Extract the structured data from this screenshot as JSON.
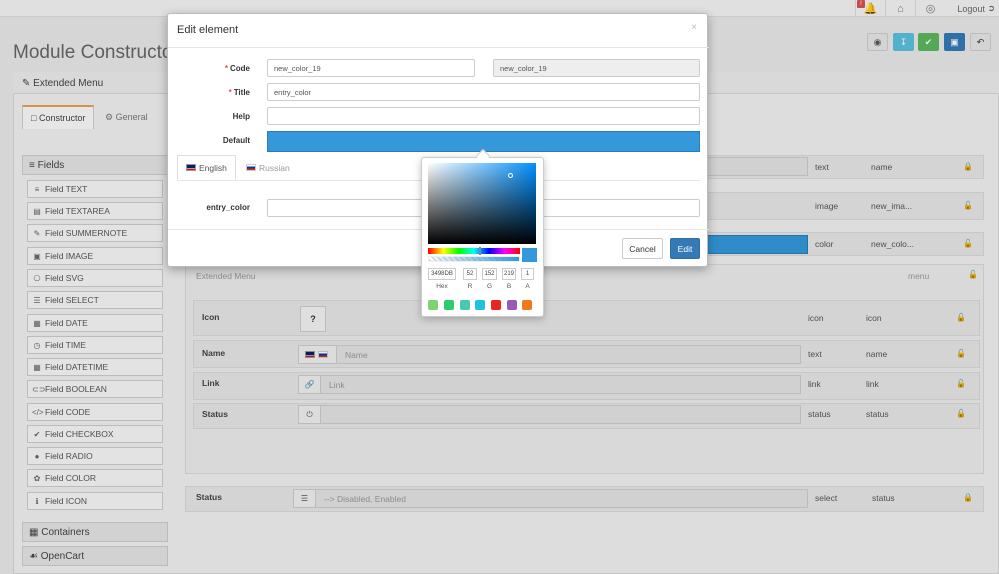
{
  "topbar": {
    "notification_count": "!",
    "logout_label": "Logout"
  },
  "page": {
    "title": "Module Constructor"
  },
  "panel": {
    "title": "Extended Menu",
    "tabs": [
      {
        "label": "Constructor"
      },
      {
        "label": "General"
      }
    ]
  },
  "sidebar": {
    "fields_header": "Fields",
    "items": [
      {
        "icon": "≡",
        "label": "Field TEXT"
      },
      {
        "icon": "▤",
        "label": "Field TEXTAREA"
      },
      {
        "icon": "✎",
        "label": "Field SUMMERNOTE"
      },
      {
        "icon": "▣",
        "label": "Field IMAGE"
      },
      {
        "icon": "⎔",
        "label": "Field SVG"
      },
      {
        "icon": "☰",
        "label": "Field SELECT"
      },
      {
        "icon": "▦",
        "label": "Field DATE"
      },
      {
        "icon": "◷",
        "label": "Field TIME"
      },
      {
        "icon": "▦",
        "label": "Field DATETIME"
      },
      {
        "icon": "⊂⊃",
        "label": "Field BOOLEAN"
      },
      {
        "icon": "</>",
        "label": "Field CODE"
      },
      {
        "icon": "✔",
        "label": "Field CHECKBOX"
      },
      {
        "icon": "●",
        "label": "Field RADIO"
      },
      {
        "icon": "✿",
        "label": "Field COLOR"
      },
      {
        "icon": "ℹ",
        "label": "Field ICON"
      }
    ],
    "containers_label": "Containers",
    "opencart_label": "OpenCart"
  },
  "rows": {
    "r1": {
      "type": "text",
      "name": "name"
    },
    "r2": {
      "type": "image",
      "name": "new_ima..."
    },
    "r3": {
      "type": "color",
      "name": "new_colo..."
    },
    "group_label": "Extended Menu",
    "group_type": "menu",
    "icon": {
      "label": "Icon",
      "btn": "?",
      "type": "icon",
      "name": "icon"
    },
    "name": {
      "label": "Name",
      "placeholder": "Name",
      "type": "text",
      "name": "name"
    },
    "link": {
      "label": "Link",
      "placeholder": "Link",
      "type": "link",
      "name": "link"
    },
    "status": {
      "label": "Status",
      "type": "status",
      "name": "status"
    },
    "status2": {
      "label": "Status",
      "placeholder": "--> Disabled, Enabled",
      "type": "select",
      "name": "status"
    }
  },
  "modal": {
    "title": "Edit element",
    "close": "×",
    "code_label": "Code",
    "code_value": "new_color_19",
    "code_readonly": "new_color_19",
    "title_label": "Title",
    "title_value": "entry_color",
    "help_label": "Help",
    "default_label": "Default",
    "default_color": "#3498db",
    "lang_tabs": [
      {
        "label": "English"
      },
      {
        "label": "Russian"
      }
    ],
    "entry_label": "entry_color",
    "cancel_label": "Cancel",
    "edit_label": "Edit"
  },
  "picker": {
    "hex": "3498DB",
    "r": "52",
    "g": "152",
    "b": "219",
    "a": "1",
    "labels": {
      "hex": "Hex",
      "r": "R",
      "g": "G",
      "b": "B",
      "a": "A"
    },
    "swatches": [
      "#7dd36d",
      "#2ecc71",
      "#48c9b0",
      "#1fc3e0",
      "#e8261f",
      "#9b59b6",
      "#f0791a"
    ]
  }
}
